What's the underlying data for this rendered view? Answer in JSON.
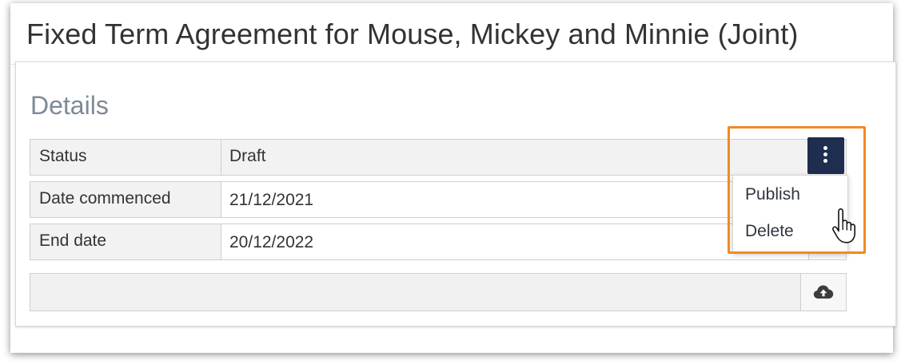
{
  "header": {
    "title": "Fixed Term Agreement for Mouse, Mickey and Minnie (Joint)"
  },
  "details": {
    "heading": "Details",
    "rows": [
      {
        "label": "Status",
        "value": "Draft"
      },
      {
        "label": "Date commenced",
        "value": "21/12/2021"
      },
      {
        "label": "End date",
        "value": "20/12/2022"
      }
    ],
    "upload_value": ""
  },
  "actions_menu": {
    "items": [
      "Publish",
      "Delete"
    ],
    "button_color": "#1f2d4f"
  },
  "annotation": {
    "highlight_color": "#f08a24"
  },
  "icons": {
    "menu": "vertical-dots-icon",
    "upload": "cloud-upload-icon",
    "cursor": "hand-pointer-cursor"
  }
}
